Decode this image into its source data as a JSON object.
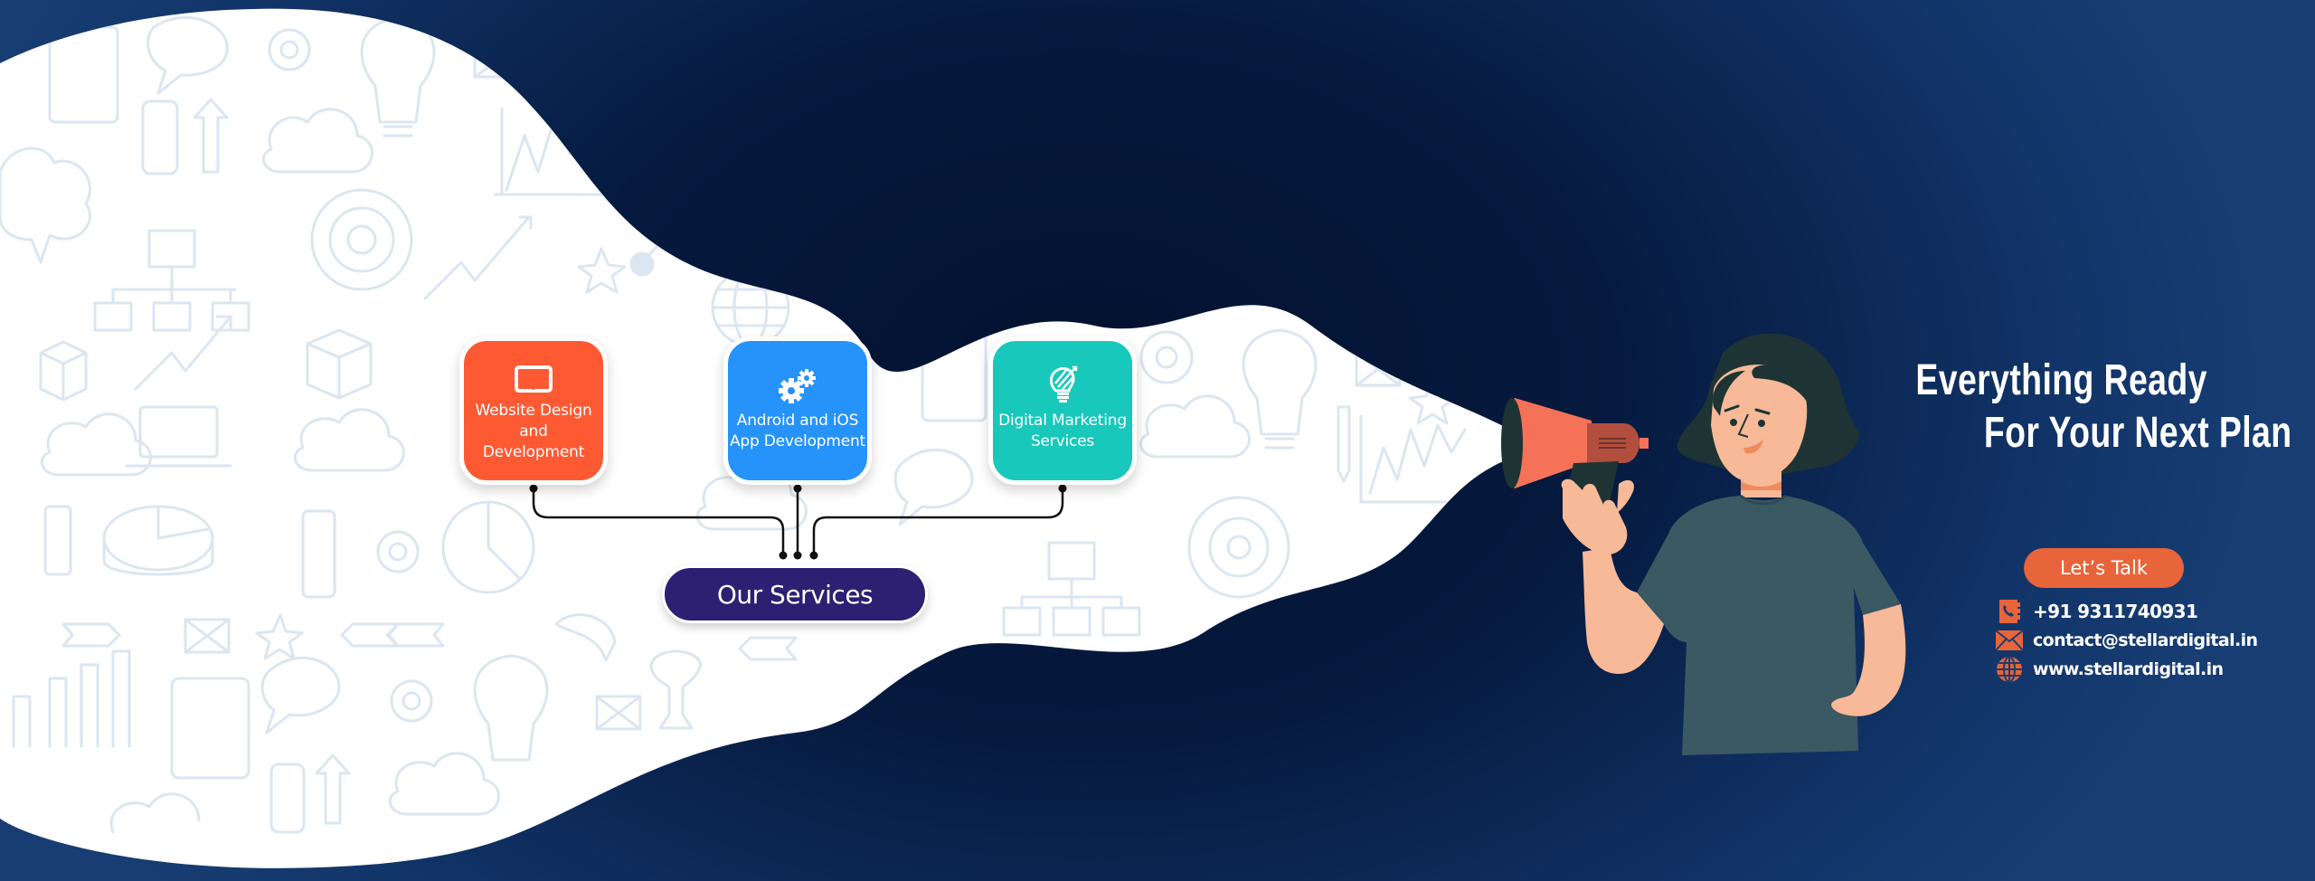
{
  "services": {
    "title": "Our Services",
    "items": [
      {
        "label_lines": [
          "Website Design",
          "and",
          "Development"
        ],
        "icon": "tablet-icon",
        "color": "#fd5a33"
      },
      {
        "label_lines": [
          "Android and iOS",
          "App Development"
        ],
        "icon": "gears-icon",
        "color": "#2693fa"
      },
      {
        "label_lines": [
          "Digital Marketing",
          "Services"
        ],
        "icon": "lightbulb-icon",
        "color": "#17c8bb"
      }
    ]
  },
  "headline": {
    "line1": "Everything Ready",
    "line2": "For Your Next Plan"
  },
  "cta": {
    "label": "Let’s Talk",
    "color": "#e8643a"
  },
  "contact": {
    "phone": "+91 9311740931",
    "email": "contact@stellardigital.in",
    "website": "www.stellardigital.in",
    "icon_color": "#e8643a"
  },
  "colors": {
    "background_dark": "#03112f",
    "background_light": "#173d72",
    "pill": "#2d1f72",
    "doodle": "#dbe6f0"
  }
}
